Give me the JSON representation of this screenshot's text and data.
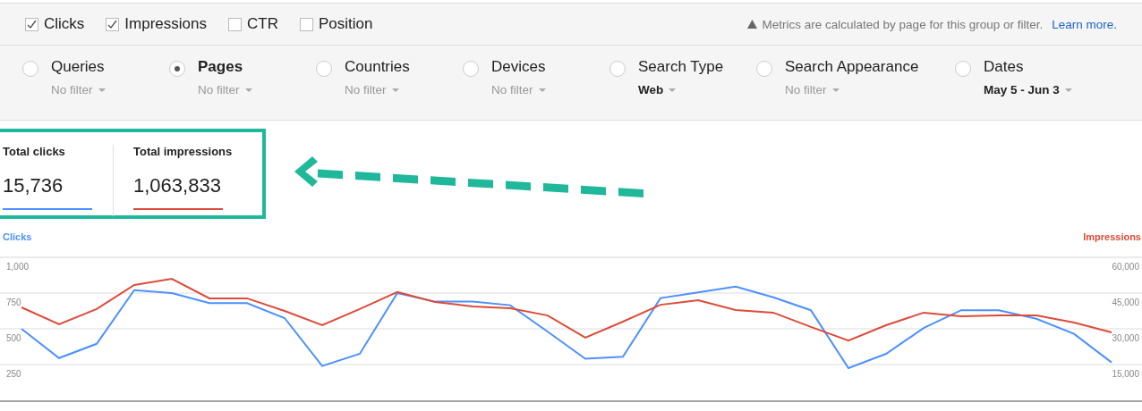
{
  "metrics": [
    {
      "label": "Clicks",
      "checked": true
    },
    {
      "label": "Impressions",
      "checked": true
    },
    {
      "label": "CTR",
      "checked": false
    },
    {
      "label": "Position",
      "checked": false
    }
  ],
  "notice": {
    "text": "Metrics are calculated by page for this group or filter.",
    "link": "Learn more."
  },
  "groups": [
    {
      "label": "Queries",
      "filter": "No filter",
      "filter_set": false,
      "selected": false
    },
    {
      "label": "Pages",
      "filter": "No filter",
      "filter_set": false,
      "selected": true
    },
    {
      "label": "Countries",
      "filter": "No filter",
      "filter_set": false,
      "selected": false
    },
    {
      "label": "Devices",
      "filter": "No filter",
      "filter_set": false,
      "selected": false
    },
    {
      "label": "Search Type",
      "filter": "Web",
      "filter_set": true,
      "selected": false
    },
    {
      "label": "Search Appearance",
      "filter": "No filter",
      "filter_set": false,
      "selected": false
    },
    {
      "label": "Dates",
      "filter": "May 5 - Jun 3",
      "filter_set": true,
      "selected": false
    }
  ],
  "totals": [
    {
      "label": "Total clicks",
      "value": "15,736",
      "color": "#4d90fe"
    },
    {
      "label": "Total impressions",
      "value": "1,063,833",
      "color": "#dd4b39"
    }
  ],
  "chart": {
    "chart_data": {
      "type": "line",
      "grid": true,
      "ylim": [
        0,
        1000
      ],
      "yticks": [
        250,
        500,
        {
          "value": 750,
          "label": "750"
        },
        {
          "value": 1000,
          "label": "1,000"
        }
      ],
      "y2lim": [
        0,
        60000
      ],
      "y2ticks": [
        {
          "value": 15000,
          "label": "15,000"
        },
        {
          "value": 30000,
          "label": "30,000"
        },
        {
          "value": 45000,
          "label": "45,000"
        },
        {
          "value": 60000,
          "label": "60,000"
        }
      ],
      "series": [
        {
          "name": "Clicks",
          "color": "#4d90fe",
          "values": [
            500,
            295,
            395,
            770,
            750,
            680,
            680,
            575,
            240,
            325,
            750,
            690,
            690,
            665,
            480,
            290,
            305,
            715,
            755,
            795,
            720,
            630,
            225,
            325,
            505,
            630,
            630,
            570,
            465,
            265
          ]
        },
        {
          "name": "Impressions",
          "color": "#dd4b39",
          "axis": "y2",
          "values": [
            39000,
            31900,
            38300,
            48400,
            51000,
            42800,
            42800,
            37500,
            31500,
            38300,
            45400,
            41300,
            39400,
            38600,
            35600,
            26300,
            33000,
            40100,
            42000,
            37900,
            36800,
            30800,
            25100,
            31500,
            36800,
            35300,
            35600,
            35600,
            32600,
            28500
          ]
        }
      ]
    }
  }
}
